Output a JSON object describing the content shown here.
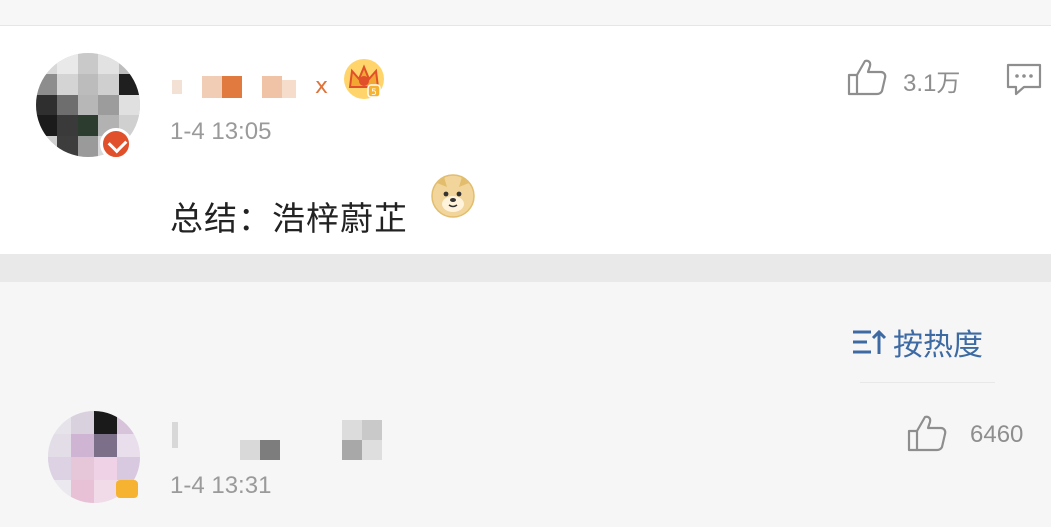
{
  "comments": [
    {
      "timestamp": "1-4 13:05",
      "text": "总结：浩梓蔚芷",
      "likes": "3.1万",
      "username_visible_suffix": "x",
      "icons": [
        "like-icon",
        "comment-icon",
        "vip-crown-icon",
        "doge-emoji-icon"
      ]
    },
    {
      "timestamp": "1-4 13:31",
      "likes": "6460",
      "icons": [
        "like-icon"
      ]
    }
  ],
  "sort": {
    "label": "按热度",
    "icon": "sort-icon"
  },
  "colors": {
    "link_blue": "#3d6aa3",
    "meta_gray": "#9a9a9a",
    "text_dark": "#222222",
    "crown_gold": "#f6b332",
    "crown_red": "#e0502a"
  }
}
